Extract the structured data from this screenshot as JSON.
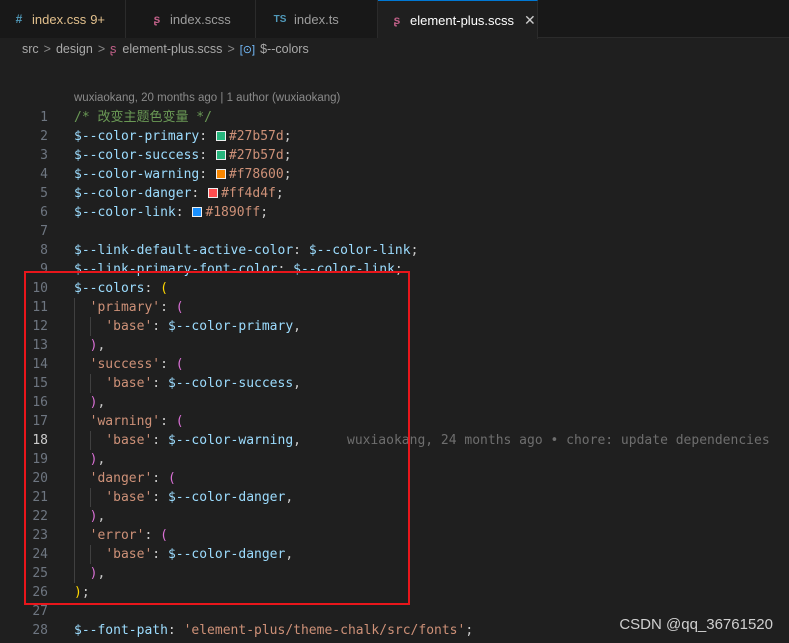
{
  "tabs": [
    {
      "icon": "#",
      "icon_color": "#519aba",
      "label": "index.css",
      "label_color": "#e2c08d",
      "badge": "9+",
      "active": false
    },
    {
      "icon": "ʂ",
      "icon_color": "#c06088",
      "label": "index.scss",
      "label_color": "#9d9d9d",
      "badge": "",
      "active": false
    },
    {
      "icon": "TS",
      "icon_color": "#519aba",
      "label": "index.ts",
      "label_color": "#9d9d9d",
      "badge": "",
      "active": false
    },
    {
      "icon": "ʂ",
      "icon_color": "#c06088",
      "label": "element-plus.scss",
      "label_color": "#ffffff",
      "badge": "",
      "active": true,
      "close": "✕"
    }
  ],
  "breadcrumb": {
    "items": [
      "src",
      "design",
      "element-plus.scss",
      "$--colors"
    ],
    "separator": ">",
    "symbol_icon": "[⊙]"
  },
  "blame_header": "wuxiaokang, 20 months ago | 1 author (wuxiaokang)",
  "code_lines": [
    {
      "n": "1",
      "tokens": [
        {
          "t": "/* 改变主题色变量 */",
          "c": "comment"
        }
      ]
    },
    {
      "n": "2",
      "tokens": [
        {
          "t": "$--color-primary",
          "c": "var"
        },
        {
          "t": ": ",
          "c": "punc"
        },
        {
          "swatch": "#27b57d"
        },
        {
          "t": "#27b57d",
          "c": "hex"
        },
        {
          "t": ";",
          "c": "punc"
        }
      ]
    },
    {
      "n": "3",
      "tokens": [
        {
          "t": "$--color-success",
          "c": "var"
        },
        {
          "t": ": ",
          "c": "punc"
        },
        {
          "swatch": "#27b57d"
        },
        {
          "t": "#27b57d",
          "c": "hex"
        },
        {
          "t": ";",
          "c": "punc"
        }
      ]
    },
    {
      "n": "4",
      "tokens": [
        {
          "t": "$--color-warning",
          "c": "var"
        },
        {
          "t": ": ",
          "c": "punc"
        },
        {
          "swatch": "#f78600"
        },
        {
          "t": "#f78600",
          "c": "hex"
        },
        {
          "t": ";",
          "c": "punc"
        }
      ]
    },
    {
      "n": "5",
      "tokens": [
        {
          "t": "$--color-danger",
          "c": "var"
        },
        {
          "t": ": ",
          "c": "punc"
        },
        {
          "swatch": "#ff4d4f"
        },
        {
          "t": "#ff4d4f",
          "c": "hex"
        },
        {
          "t": ";",
          "c": "punc"
        }
      ]
    },
    {
      "n": "6",
      "tokens": [
        {
          "t": "$--color-link",
          "c": "var"
        },
        {
          "t": ": ",
          "c": "punc"
        },
        {
          "swatch": "#1890ff"
        },
        {
          "t": "#1890ff",
          "c": "hex"
        },
        {
          "t": ";",
          "c": "punc"
        }
      ]
    },
    {
      "n": "7",
      "tokens": []
    },
    {
      "n": "8",
      "tokens": [
        {
          "t": "$--link-default-active-color",
          "c": "var"
        },
        {
          "t": ": ",
          "c": "punc"
        },
        {
          "t": "$--color-link",
          "c": "var"
        },
        {
          "t": ";",
          "c": "punc"
        }
      ]
    },
    {
      "n": "9",
      "tokens": [
        {
          "t": "$--link-primary-font-color",
          "c": "var"
        },
        {
          "t": ": ",
          "c": "punc"
        },
        {
          "t": "$--color-link",
          "c": "var"
        },
        {
          "t": ";",
          "c": "punc"
        }
      ]
    },
    {
      "n": "10",
      "tokens": [
        {
          "t": "$--colors",
          "c": "var"
        },
        {
          "t": ": ",
          "c": "punc"
        },
        {
          "t": "(",
          "c": "paren3"
        }
      ]
    },
    {
      "n": "11",
      "guides": 1,
      "tokens": [
        {
          "t": "  ",
          "c": "punc"
        },
        {
          "t": "'primary'",
          "c": "str"
        },
        {
          "t": ": ",
          "c": "punc"
        },
        {
          "t": "(",
          "c": "paren"
        }
      ]
    },
    {
      "n": "12",
      "guides": 2,
      "tokens": [
        {
          "t": "    ",
          "c": "punc"
        },
        {
          "t": "'base'",
          "c": "str"
        },
        {
          "t": ": ",
          "c": "punc"
        },
        {
          "t": "$--color-primary",
          "c": "var"
        },
        {
          "t": ",",
          "c": "punc"
        }
      ]
    },
    {
      "n": "13",
      "guides": 1,
      "tokens": [
        {
          "t": "  ",
          "c": "punc"
        },
        {
          "t": ")",
          "c": "paren"
        },
        {
          "t": ",",
          "c": "punc"
        }
      ]
    },
    {
      "n": "14",
      "guides": 1,
      "tokens": [
        {
          "t": "  ",
          "c": "punc"
        },
        {
          "t": "'success'",
          "c": "str"
        },
        {
          "t": ": ",
          "c": "punc"
        },
        {
          "t": "(",
          "c": "paren"
        }
      ]
    },
    {
      "n": "15",
      "guides": 2,
      "tokens": [
        {
          "t": "    ",
          "c": "punc"
        },
        {
          "t": "'base'",
          "c": "str"
        },
        {
          "t": ": ",
          "c": "punc"
        },
        {
          "t": "$--color-success",
          "c": "var"
        },
        {
          "t": ",",
          "c": "punc"
        }
      ]
    },
    {
      "n": "16",
      "guides": 1,
      "tokens": [
        {
          "t": "  ",
          "c": "punc"
        },
        {
          "t": ")",
          "c": "paren"
        },
        {
          "t": ",",
          "c": "punc"
        }
      ]
    },
    {
      "n": "17",
      "guides": 1,
      "tokens": [
        {
          "t": "  ",
          "c": "punc"
        },
        {
          "t": "'warning'",
          "c": "str"
        },
        {
          "t": ": ",
          "c": "punc"
        },
        {
          "t": "(",
          "c": "paren"
        }
      ]
    },
    {
      "n": "18",
      "guides": 2,
      "current": true,
      "tokens": [
        {
          "t": "    ",
          "c": "punc"
        },
        {
          "t": "'base'",
          "c": "str"
        },
        {
          "t": ": ",
          "c": "punc"
        },
        {
          "t": "$--color-warning",
          "c": "var"
        },
        {
          "t": ",",
          "c": "punc"
        }
      ],
      "inline_blame": "wuxiaokang, 24 months ago • chore: update dependencies"
    },
    {
      "n": "19",
      "guides": 1,
      "tokens": [
        {
          "t": "  ",
          "c": "punc"
        },
        {
          "t": ")",
          "c": "paren"
        },
        {
          "t": ",",
          "c": "punc"
        }
      ]
    },
    {
      "n": "20",
      "guides": 1,
      "tokens": [
        {
          "t": "  ",
          "c": "punc"
        },
        {
          "t": "'danger'",
          "c": "str"
        },
        {
          "t": ": ",
          "c": "punc"
        },
        {
          "t": "(",
          "c": "paren"
        }
      ]
    },
    {
      "n": "21",
      "guides": 2,
      "tokens": [
        {
          "t": "    ",
          "c": "punc"
        },
        {
          "t": "'base'",
          "c": "str"
        },
        {
          "t": ": ",
          "c": "punc"
        },
        {
          "t": "$--color-danger",
          "c": "var"
        },
        {
          "t": ",",
          "c": "punc"
        }
      ]
    },
    {
      "n": "22",
      "guides": 1,
      "tokens": [
        {
          "t": "  ",
          "c": "punc"
        },
        {
          "t": ")",
          "c": "paren"
        },
        {
          "t": ",",
          "c": "punc"
        }
      ]
    },
    {
      "n": "23",
      "guides": 1,
      "tokens": [
        {
          "t": "  ",
          "c": "punc"
        },
        {
          "t": "'error'",
          "c": "str"
        },
        {
          "t": ": ",
          "c": "punc"
        },
        {
          "t": "(",
          "c": "paren"
        }
      ]
    },
    {
      "n": "24",
      "guides": 2,
      "tokens": [
        {
          "t": "    ",
          "c": "punc"
        },
        {
          "t": "'base'",
          "c": "str"
        },
        {
          "t": ": ",
          "c": "punc"
        },
        {
          "t": "$--color-danger",
          "c": "var"
        },
        {
          "t": ",",
          "c": "punc"
        }
      ]
    },
    {
      "n": "25",
      "guides": 1,
      "tokens": [
        {
          "t": "  ",
          "c": "punc"
        },
        {
          "t": ")",
          "c": "paren"
        },
        {
          "t": ",",
          "c": "punc"
        }
      ]
    },
    {
      "n": "26",
      "tokens": [
        {
          "t": ")",
          "c": "paren3"
        },
        {
          "t": ";",
          "c": "punc"
        }
      ]
    },
    {
      "n": "27",
      "tokens": []
    },
    {
      "n": "28",
      "tokens": [
        {
          "t": "$--font-path",
          "c": "var"
        },
        {
          "t": ": ",
          "c": "punc"
        },
        {
          "t": "'element-plus/theme-chalk/src/fonts'",
          "c": "str"
        },
        {
          "t": ";",
          "c": "punc"
        }
      ]
    }
  ],
  "highlight_color": "#e8161b",
  "watermark": "CSDN @qq_36761520"
}
